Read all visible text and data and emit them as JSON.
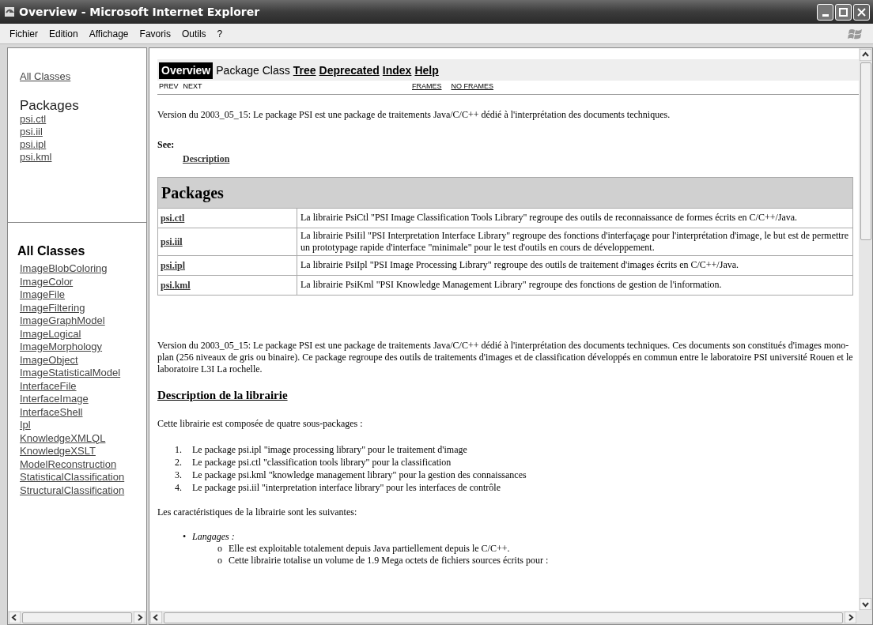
{
  "window": {
    "title": "Overview - Microsoft Internet Explorer"
  },
  "menu": [
    "Fichier",
    "Edition",
    "Affichage",
    "Favoris",
    "Outils",
    "?"
  ],
  "left_top": {
    "all_classes_link": "All Classes",
    "packages_heading": "Packages",
    "packages": [
      "psi.ctl",
      "psi.iil",
      "psi.ipl",
      "psi.kml"
    ]
  },
  "left_bottom": {
    "heading": "All Classes",
    "classes": [
      "ImageBlobColoring",
      "ImageColor",
      "ImageFile",
      "ImageFiltering",
      "ImageGraphModel",
      "ImageLogical",
      "ImageMorphology",
      "ImageObject",
      "ImageStatisticalModel",
      "InterfaceFile",
      "InterfaceImage",
      "InterfaceShell",
      "Ipl",
      "KnowledgeXMLQL",
      "KnowledgeXSLT",
      "ModelReconstruction",
      "StatisticalClassification",
      "StructuralClassification"
    ]
  },
  "nav": {
    "tabs": [
      {
        "label": "Overview",
        "kind": "current"
      },
      {
        "label": "Package",
        "kind": "text"
      },
      {
        "label": "Class",
        "kind": "text"
      },
      {
        "label": "Tree",
        "kind": "link"
      },
      {
        "label": "Deprecated",
        "kind": "link"
      },
      {
        "label": "Index",
        "kind": "link"
      },
      {
        "label": "Help",
        "kind": "link"
      }
    ],
    "prev_next": [
      "PREV",
      "NEXT"
    ],
    "frames": [
      "FRAMES",
      "NO FRAMES"
    ]
  },
  "intro": "Version du 2003_05_15: Le package PSI est une package de traitements Java/C/C++ dédié à l'interprétation des documents techniques.",
  "see": {
    "label": "See:",
    "link": "Description"
  },
  "packages_table": {
    "title": "Packages",
    "rows": [
      {
        "name": "psi.ctl",
        "description": "La librairie PsiCtl \"PSI Image Classification Tools Library\" regroupe des outils de reconnaissance de formes écrits en C/C++/Java."
      },
      {
        "name": "psi.iil",
        "description": "La librairie PsiIil \"PSI Interpretation Interface Library\" regroupe des fonctions d'interfaçage pour l'interprétation d'image, le but est de permettre un prototypage rapide d'interface \"minimale\" pour le test d'outils en cours de développement."
      },
      {
        "name": "psi.ipl",
        "description": "La librairie PsiIpl \"PSI Image Processing Library\" regroupe des outils de traitement d'images écrits en C/C++/Java."
      },
      {
        "name": "psi.kml",
        "description": "La librairie PsiKml \"PSI Knowledge Management Library\" regroupe des fonctions de gestion de l'information."
      }
    ]
  },
  "long_intro": "Version du 2003_05_15: Le package PSI est une package de traitements Java/C/C++ dédié à l'interprétation des documents techniques. Ces documents son constitués d'images mono-plan (256 niveaux de gris ou binaire). Ce package regroupe des outils de traitements d'images et de classification développés en commun entre le laboratoire PSI université Rouen et le laboratoire L3I La rochelle.",
  "description_heading": "Description de la librairie",
  "composition": "Cette librairie est composée de quatre sous-packages :",
  "subpackages": [
    {
      "number": "1.",
      "text": "Le package psi.ipl \"image processing library\" pour le traitement d'image"
    },
    {
      "number": "2.",
      "text": "Le package psi.ctl \"classification tools library\" pour la classification"
    },
    {
      "number": "3.",
      "text": "Le package psi.kml \"knowledge management library\" pour la gestion des connaissances"
    },
    {
      "number": "4.",
      "text": "Le package psi.iil \"interpretation interface library\" pour les interfaces de contrôle"
    }
  ],
  "features_intro": "Les caractéristiques de la librairie sont les suivantes:",
  "features": [
    {
      "bullet": "•",
      "label": "Langages :",
      "items": [
        {
          "bullet": "o",
          "text": "Elle est exploitable totalement depuis Java partiellement depuis le C/C++."
        },
        {
          "bullet": "o",
          "text": "Cette librairie totalise un volume de 1.9 Mega octets de fichiers sources écrits pour :"
        }
      ]
    }
  ]
}
